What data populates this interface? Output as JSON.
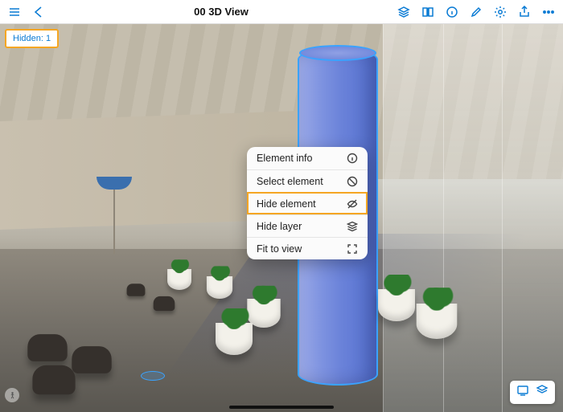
{
  "colors": {
    "accent": "#0a7bd4",
    "highlight": "#f5a623"
  },
  "toolbar": {
    "title": "00 3D View",
    "left_icons": [
      "menu-icon",
      "back-icon"
    ],
    "right_icons": [
      "layers-icon",
      "book-icon",
      "info-icon",
      "pencil-icon",
      "gear-icon",
      "share-icon",
      "more-icon"
    ]
  },
  "hidden_badge": {
    "label": "Hidden: 1"
  },
  "selection": {
    "element": "column",
    "highlighted": true
  },
  "context_menu": {
    "items": [
      {
        "label": "Element info",
        "icon": "info-circle-icon",
        "highlighted": false
      },
      {
        "label": "Select element",
        "icon": "target-icon",
        "highlighted": false
      },
      {
        "label": "Hide element",
        "icon": "eye-off-icon",
        "highlighted": true
      },
      {
        "label": "Hide layer",
        "icon": "layers-icon",
        "highlighted": false
      },
      {
        "label": "Fit to view",
        "icon": "fit-icon",
        "highlighted": false
      }
    ]
  },
  "bottom_right": {
    "icons": [
      "screen-icon",
      "layer-stack-icon"
    ]
  }
}
